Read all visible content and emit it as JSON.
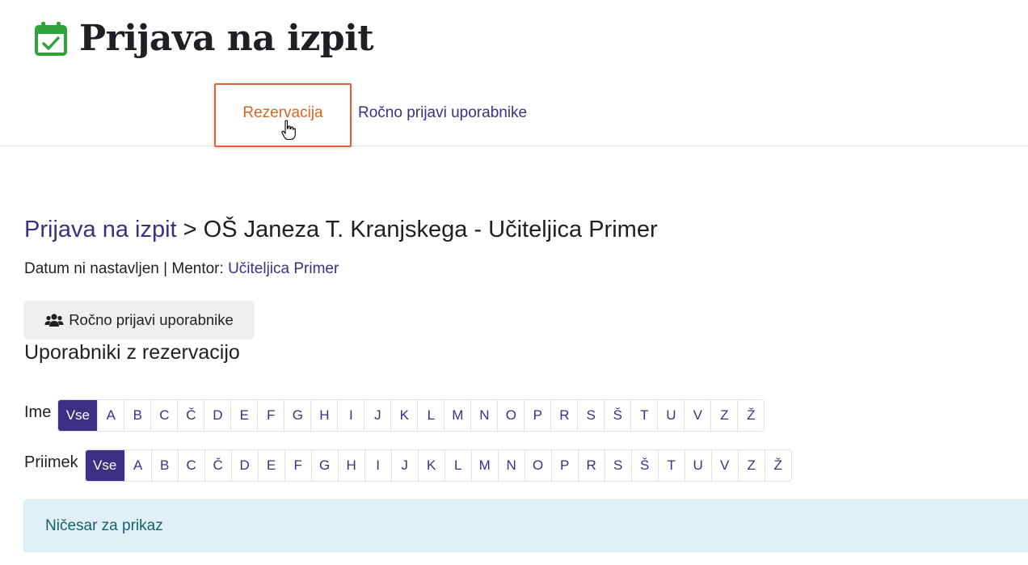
{
  "header": {
    "title": "Prijava na izpit",
    "icon": "calendar-check-icon",
    "icon_color": "#2ea43a"
  },
  "tabs": [
    {
      "label": "Rezervacija",
      "state": "highlighted"
    },
    {
      "label": "Ročno prijavi uporabnike"
    }
  ],
  "breadcrumb": {
    "link": "Prijava na izpit",
    "separator": ">",
    "current": "OŠ Janeza T. Kranjskega - Učiteljica Primer"
  },
  "meta": {
    "date_text": "Datum ni nastavljen",
    "divider": "|",
    "mentor_label": "Mentor:",
    "mentor_name": "Učiteljica Primer"
  },
  "manual_button": {
    "label": "Ročno prijavi uporabnike",
    "icon": "users-icon"
  },
  "section": {
    "title": "Uporabniki z rezervacijo"
  },
  "filters": {
    "first_name": {
      "label": "Ime",
      "active": "Vse"
    },
    "last_name": {
      "label": "Priimek",
      "active": "Vse"
    },
    "letters": [
      "Vse",
      "A",
      "B",
      "C",
      "Č",
      "D",
      "E",
      "F",
      "G",
      "H",
      "I",
      "J",
      "K",
      "L",
      "M",
      "N",
      "O",
      "P",
      "R",
      "S",
      "Š",
      "T",
      "U",
      "V",
      "Z",
      "Ž"
    ]
  },
  "empty_message": "Ničesar za prikaz",
  "colors": {
    "accent": "#3c3085",
    "highlight": "#e2613a",
    "info_bg": "#dff1f6",
    "info_text": "#17606f"
  }
}
